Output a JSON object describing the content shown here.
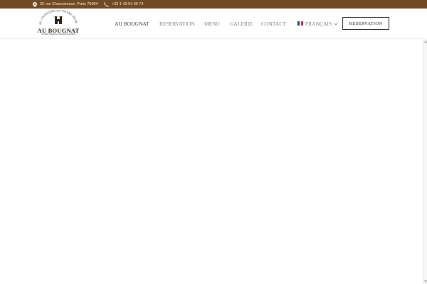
{
  "topbar": {
    "address": "26 rue Chanoinesse, Paris 75004",
    "phone": "+33 1 43 54 30 74",
    "address_icon": "map-pin-icon",
    "phone_icon": "phone-icon"
  },
  "logo": {
    "arc_text": "AU CHANTIER DE NOTRE-DAME",
    "name": "AU BOUGNAT",
    "tagline": "CUISINE FAMILIALE SAVEURS DE PARIS"
  },
  "nav": {
    "items": [
      "AU BOUGNAT",
      "RESERVATION",
      "MENU",
      "GALERIE",
      "CONTACT"
    ],
    "language": "FRANÇAIS",
    "cta": "RESERVATION"
  },
  "colors": {
    "topbar_bg": "#6f4a22",
    "nav_text": "#8a7d70",
    "nav_active": "#3a2f26",
    "button_border": "#2e2620"
  }
}
